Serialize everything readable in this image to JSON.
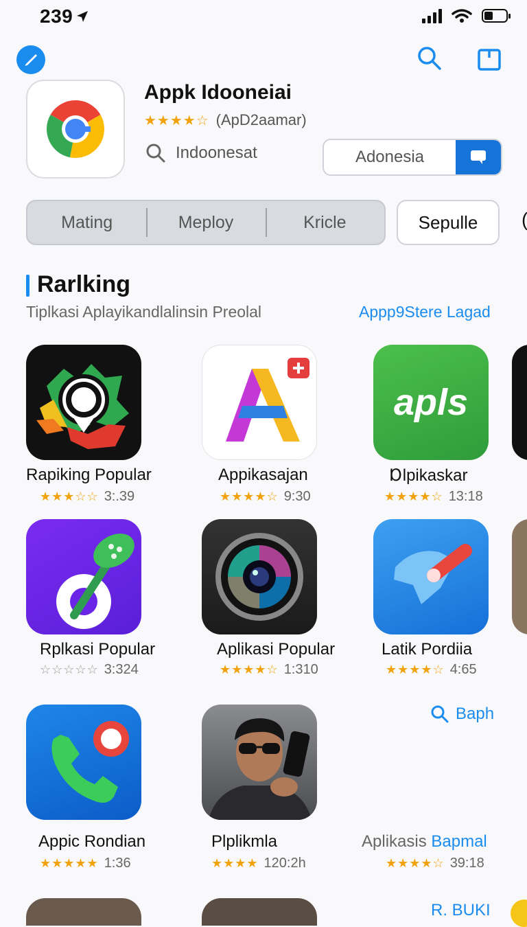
{
  "status": {
    "time": "239"
  },
  "app": {
    "title": "Appk Idooneiai",
    "stars": "★★★★☆",
    "rating_meta": "(ApD2aamar)",
    "search_text": "Indoonesat",
    "region": "Adonesia"
  },
  "segments": [
    "Mating",
    "Meploy",
    "Kricle"
  ],
  "segment_button": "Sepulle",
  "ranking": {
    "title": "Rarlking",
    "subtitle": "Tiplkasi  Aplayikandlalinsin Preolal",
    "link": "Appp9Stere Lagad"
  },
  "apps": [
    {
      "name": "Rapiking Popular",
      "stars": "★★★☆☆",
      "value": "3:.39"
    },
    {
      "name": "Appikasajan",
      "stars": "★★★★☆",
      "value": "9:30"
    },
    {
      "name": "Ɒlpikaskar",
      "stars": "★★★★☆",
      "value": "13:18"
    },
    {
      "name": "Rplkasi Popular",
      "stars": "☆☆☆☆☆",
      "value": "3:324"
    },
    {
      "name": "Aplikasi Popular",
      "stars": "★★★★☆",
      "value": "1:310"
    },
    {
      "name": "Latik Pordiia",
      "stars": "★★★★☆",
      "value": "4:65"
    },
    {
      "name": "Appic Rondian",
      "stars": "★★★★★",
      "value": "1:36"
    },
    {
      "name": "Plplikmla",
      "stars": "★★★★",
      "value": "120:2h"
    }
  ],
  "tile3_text": "apls",
  "side_link_1": "Baph",
  "side_item": {
    "name_a": "Aplikasis ",
    "name_b": "Bapmal",
    "stars": "★★★★☆",
    "value": "39:18"
  },
  "bottom_link": "R. BUKI",
  "icons": [
    "location-arrow-icon",
    "battery-icon",
    "wifi-icon",
    "signal-icon",
    "search-icon",
    "share-square-icon",
    "chrome-logo-icon"
  ]
}
